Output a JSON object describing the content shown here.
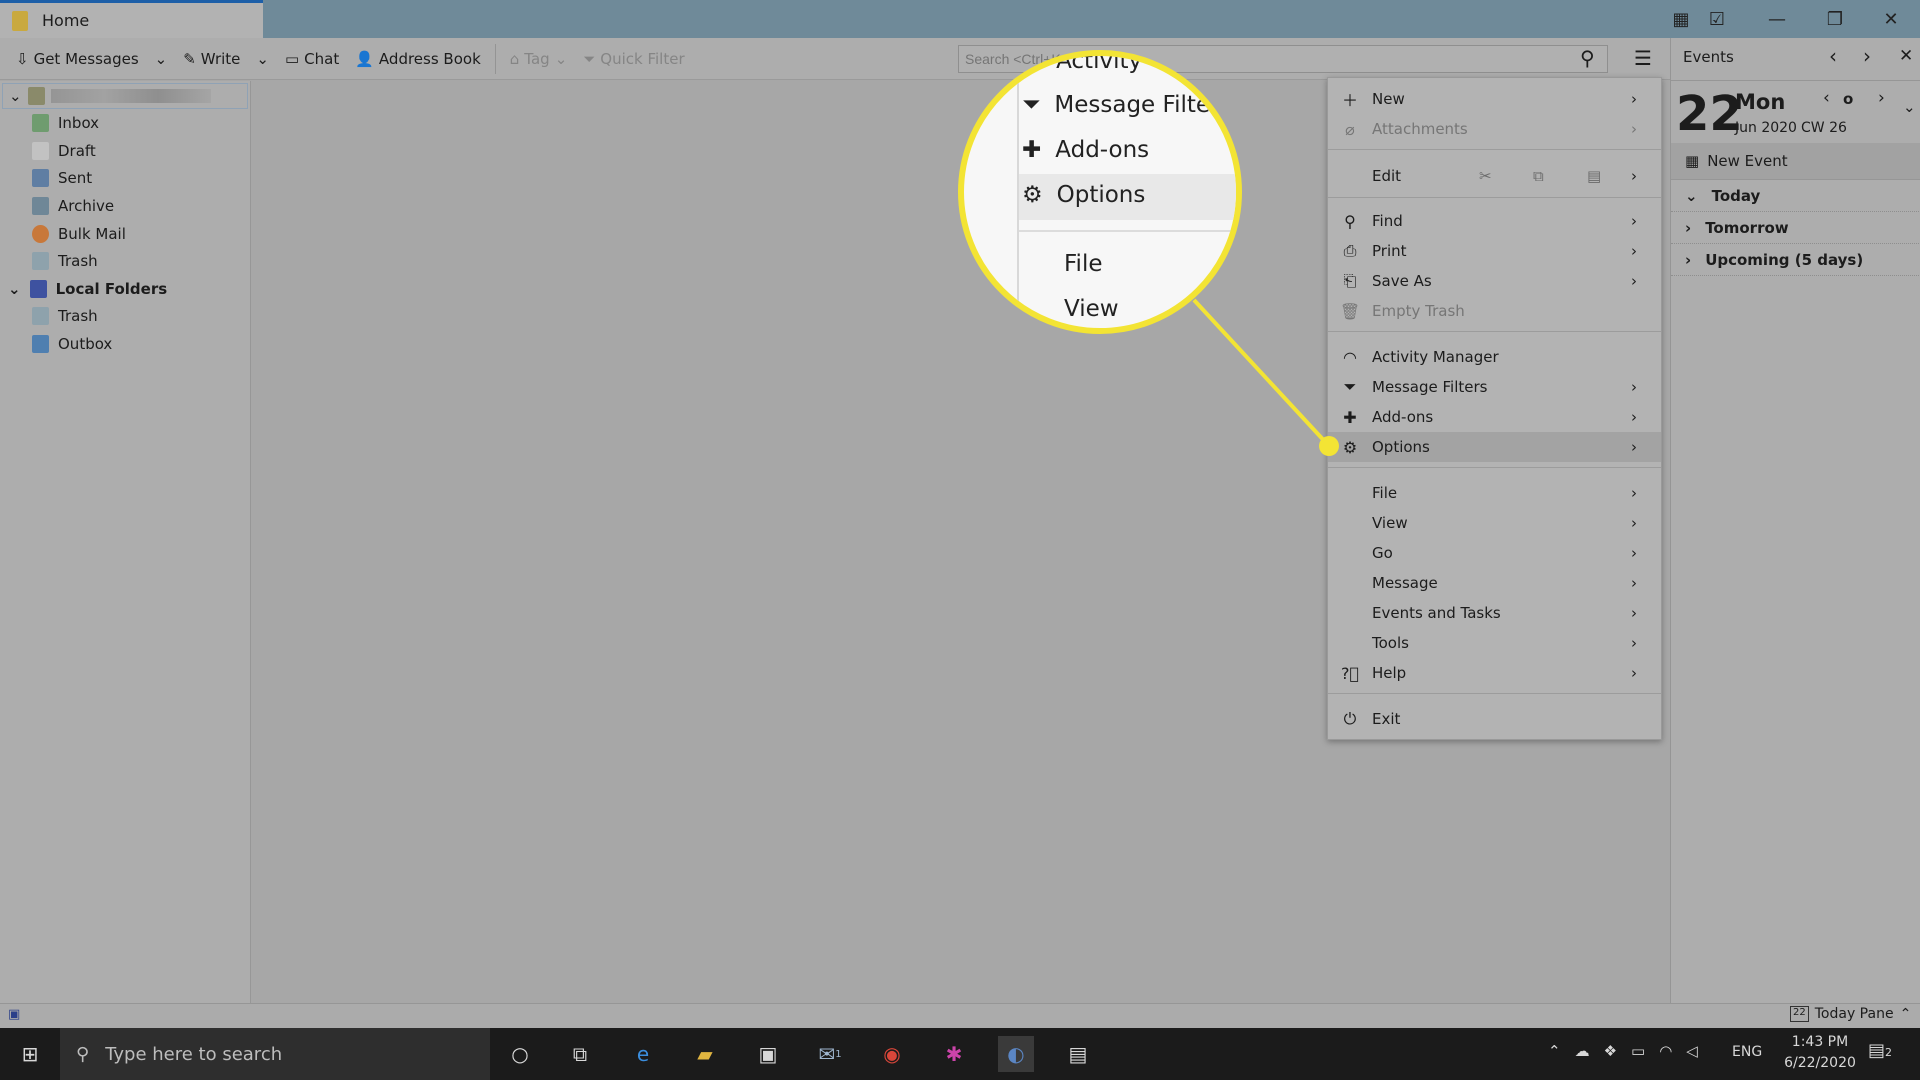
{
  "window": {
    "tab_title": "Home"
  },
  "toolbar": {
    "get_messages": "Get Messages",
    "write": "Write",
    "chat": "Chat",
    "address_book": "Address Book",
    "tag": "Tag",
    "quick_filter": "Quick Filter",
    "search_placeholder": "Search <Ctrl+K>"
  },
  "folders": {
    "items": [
      "Inbox",
      "Draft",
      "Sent",
      "Archive",
      "Bulk Mail",
      "Trash"
    ],
    "local_folders": "Local Folders",
    "local_items": [
      "Trash",
      "Outbox"
    ]
  },
  "menu": {
    "new": "New",
    "attachments": "Attachments",
    "edit": "Edit",
    "find": "Find",
    "print": "Print",
    "save_as": "Save As",
    "empty_trash": "Empty Trash",
    "activity_manager": "Activity Manager",
    "message_filters": "Message Filters",
    "addons": "Add-ons",
    "options": "Options",
    "file": "File",
    "view": "View",
    "go": "Go",
    "message": "Message",
    "events_tasks": "Events and Tasks",
    "tools": "Tools",
    "help": "Help",
    "exit": "Exit"
  },
  "magnifier": {
    "items": [
      "Activity",
      "Message Filte",
      "Add-ons",
      "Options",
      "File",
      "View"
    ],
    "highlight_color": "#f3e434"
  },
  "today_pane": {
    "title": "Events",
    "day": "22",
    "weekday": "Mon",
    "month_year": "Jun 2020",
    "week": "CW 26",
    "new_event": "New Event",
    "sections": [
      "Today",
      "Tomorrow",
      "Upcoming (5 days)"
    ],
    "toggle_label": "Today Pane",
    "toggle_icon_day": "22"
  },
  "taskbar": {
    "search_placeholder": "Type here to search",
    "language": "ENG",
    "time": "1:43 PM",
    "date": "6/22/2020",
    "notifications": "2",
    "mail_badge": "1"
  }
}
